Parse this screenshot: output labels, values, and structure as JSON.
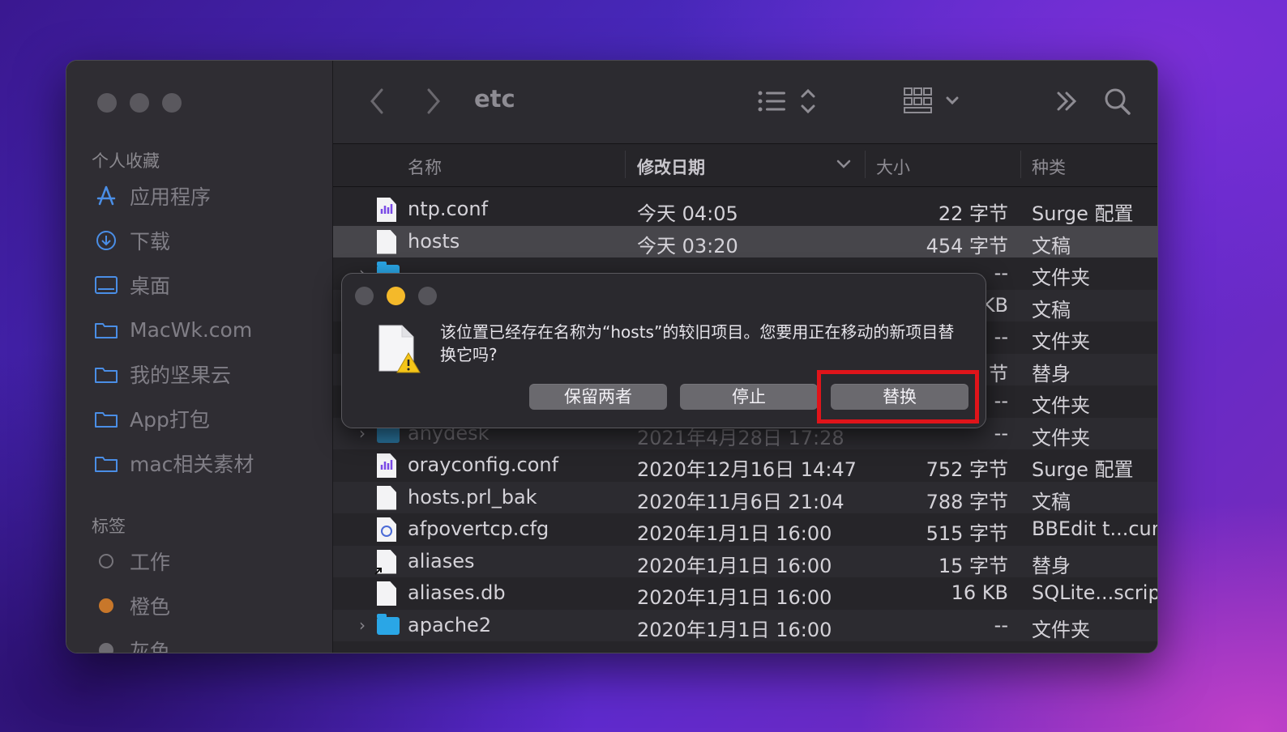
{
  "toolbar": {
    "title": "etc"
  },
  "sidebar": {
    "favorites_header": "个人收藏",
    "favorites": [
      {
        "label": "应用程序",
        "icon": "applications-icon"
      },
      {
        "label": "下载",
        "icon": "downloads-icon"
      },
      {
        "label": "桌面",
        "icon": "desktop-icon"
      },
      {
        "label": "MacWk.com",
        "icon": "folder-icon"
      },
      {
        "label": "我的坚果云",
        "icon": "folder-icon"
      },
      {
        "label": "App打包",
        "icon": "folder-icon"
      },
      {
        "label": "mac相关素材",
        "icon": "folder-icon"
      }
    ],
    "tags_header": "标签",
    "tags": [
      {
        "label": "工作",
        "color": "#2f2d33"
      },
      {
        "label": "橙色",
        "color": "#d9822b"
      },
      {
        "label": "灰色",
        "color": "#8e8c93"
      }
    ]
  },
  "columns": {
    "name": "名称",
    "date": "修改日期",
    "size": "大小",
    "kind": "种类"
  },
  "files": [
    {
      "name": "ntp.conf",
      "date": "今天 04:05",
      "size": "22 字节",
      "kind": "Surge 配置",
      "type": "surge"
    },
    {
      "name": "hosts",
      "date": "今天 03:20",
      "size": "454 字节",
      "kind": "文稿",
      "type": "doc",
      "selected": true
    },
    {
      "name": "",
      "date": "",
      "size": "--",
      "kind": "文件夹",
      "type": "folder",
      "hidden": true
    },
    {
      "name": "",
      "date": "",
      "size": "KB",
      "kind": "文稿",
      "type": "doc",
      "hidden": true
    },
    {
      "name": "",
      "date": "",
      "size": "--",
      "kind": "文件夹",
      "type": "folder",
      "hidden": true
    },
    {
      "name": "",
      "date": "",
      "size": "节",
      "kind": "替身",
      "type": "doc",
      "hidden": true
    },
    {
      "name": "",
      "date": "",
      "size": "--",
      "kind": "文件夹",
      "type": "folder",
      "hidden": true
    },
    {
      "name": "anydesk",
      "date": "2021年4月28日 17:28",
      "size": "--",
      "kind": "文件夹",
      "type": "folder",
      "dim": true
    },
    {
      "name": "orayconfig.conf",
      "date": "2020年12月16日 14:47",
      "size": "752 字节",
      "kind": "Surge 配置",
      "type": "surge"
    },
    {
      "name": "hosts.prl_bak",
      "date": "2020年11月6日 21:04",
      "size": "788 字节",
      "kind": "文稿",
      "type": "doc"
    },
    {
      "name": "afpovertcp.cfg",
      "date": "2020年1月1日 16:00",
      "size": "515 字节",
      "kind": "BBEdit t...cum",
      "type": "bbedit"
    },
    {
      "name": "aliases",
      "date": "2020年1月1日 16:00",
      "size": "15 字节",
      "kind": "替身",
      "type": "alias"
    },
    {
      "name": "aliases.db",
      "date": "2020年1月1日 16:00",
      "size": "16 KB",
      "kind": "SQLite...script",
      "type": "doc"
    },
    {
      "name": "apache2",
      "date": "2020年1月1日 16:00",
      "size": "--",
      "kind": "文件夹",
      "type": "folder"
    }
  ],
  "dialog": {
    "message": "该位置已经存在名称为“hosts”的较旧项目。您要用正在移动的新项目替换它吗?",
    "keep_both": "保留两者",
    "stop": "停止",
    "replace": "替换"
  }
}
